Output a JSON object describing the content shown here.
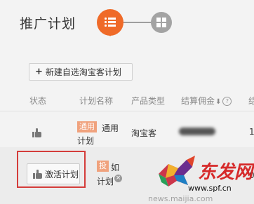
{
  "header": {
    "title": "推广计划",
    "steps": [
      {
        "name": "list-icon",
        "color": "#ef6a28",
        "active": true
      },
      {
        "name": "grid-icon",
        "color": "#a3a3a3",
        "active": false
      }
    ]
  },
  "toolbar": {
    "new_plan_label": "新建自选淘宝客计划",
    "plus_glyph": "+"
  },
  "table": {
    "columns": [
      "状态",
      "计划名称",
      "产品类型",
      "结算佣金",
      "结"
    ],
    "sort_glyph": "⬇",
    "help_glyph": "?",
    "rows": [
      {
        "status_icon": "thumbs-up-icon",
        "tag": "通用",
        "name": "通用",
        "name_line2": "计划",
        "product_type": "淘宝客",
        "commission": "",
        "trailing": "1"
      },
      {
        "activate_label": "激活计划",
        "tag": "投",
        "name": "如",
        "name_line2": "计划",
        "trailing": "0"
      }
    ]
  },
  "watermark": {
    "logo_text": "东发网",
    "url": "www.spf.cn",
    "url2": "news.maijia.com"
  },
  "colors": {
    "accent": "#ef6a28",
    "tag": "#f0a27d",
    "highlight": "#d43d3a"
  }
}
